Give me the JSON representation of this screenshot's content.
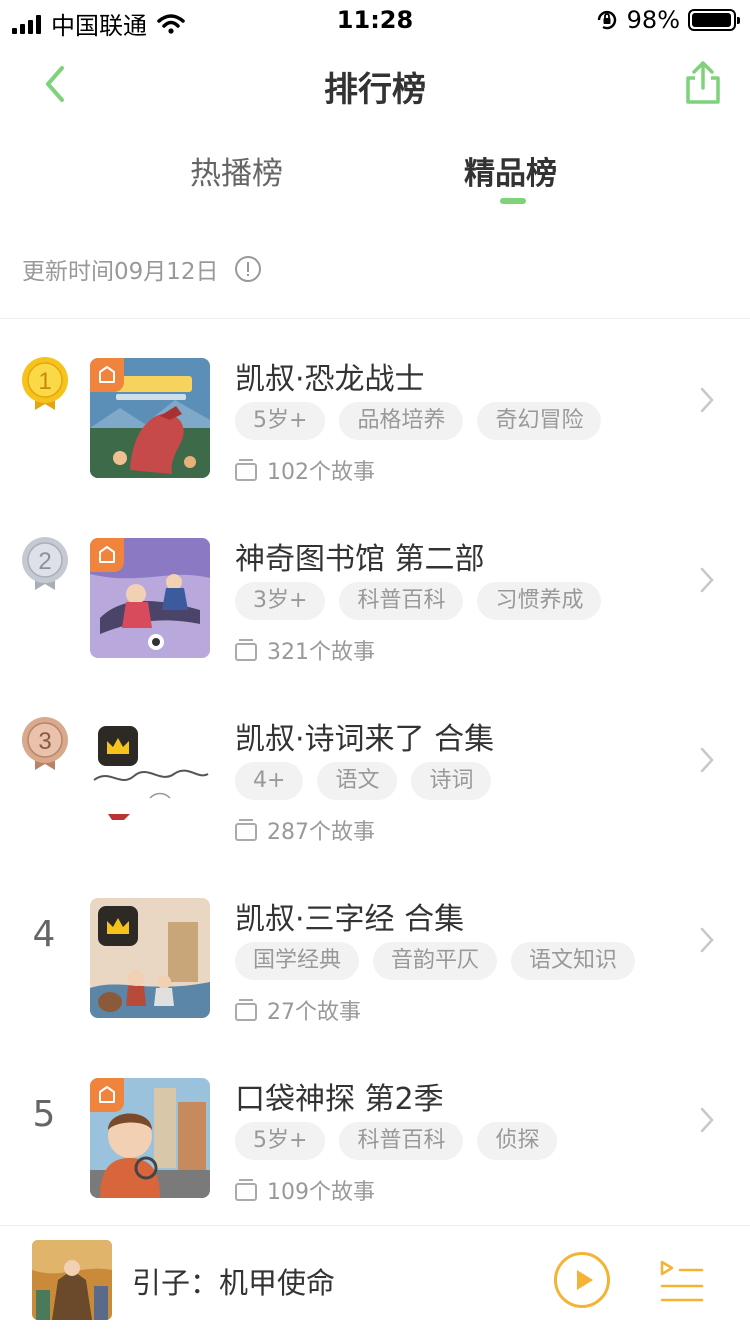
{
  "status_bar": {
    "carrier": "中国联通",
    "time": "11:28",
    "battery": "98%",
    "battery_level": 0.98
  },
  "nav": {
    "title": "排行榜"
  },
  "tabs": [
    {
      "label": "热播榜",
      "active": false
    },
    {
      "label": "精品榜",
      "active": true
    }
  ],
  "update_time": "更新时间09月12日",
  "list": [
    {
      "rank": "1",
      "title": "凯叔·恐龙战士",
      "tags": [
        "5岁+",
        "品格培养",
        "奇幻冒险"
      ],
      "count": "102个故事",
      "cover_badge": "ticket-icon"
    },
    {
      "rank": "2",
      "title": "神奇图书馆 第二部",
      "tags": [
        "3岁+",
        "科普百科",
        "习惯养成"
      ],
      "count": "321个故事",
      "cover_badge": "ticket-icon"
    },
    {
      "rank": "3",
      "title": "凯叔·诗词来了 合集",
      "tags": [
        "4+",
        "语文",
        "诗词"
      ],
      "count": "287个故事",
      "cover_badge": "crown-icon"
    },
    {
      "rank": "4",
      "title": "凯叔·三字经 合集",
      "tags": [
        "国学经典",
        "音韵平仄",
        "语文知识"
      ],
      "count": "27个故事",
      "cover_badge": "crown-icon"
    },
    {
      "rank": "5",
      "title": "口袋神探 第2季",
      "tags": [
        "5岁+",
        "科普百科",
        "侦探"
      ],
      "count": "109个故事",
      "cover_badge": "ticket-icon"
    }
  ],
  "player": {
    "title": "引子：机甲使命"
  },
  "colors": {
    "accent_green": "#7ed37a",
    "player_orange": "#f5b335",
    "gold": "#f6c21c",
    "silver": "#c5c9d2",
    "bronze": "#d8a98c"
  }
}
